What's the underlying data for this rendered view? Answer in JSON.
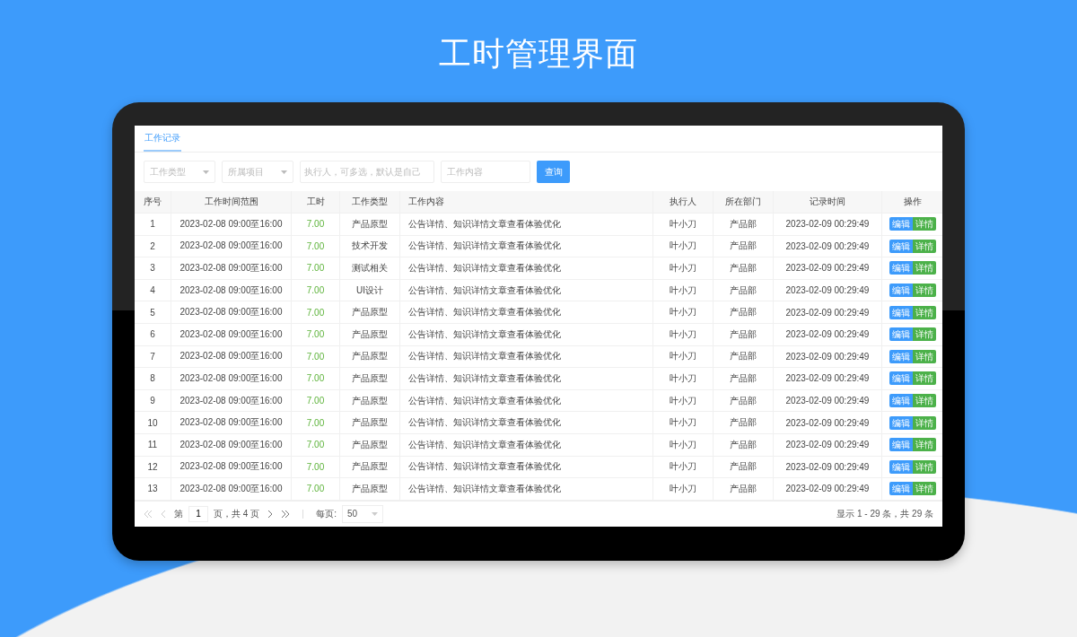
{
  "title": "工时管理界面",
  "tabs": [
    {
      "label": "工作记录",
      "selected": true
    }
  ],
  "filters": [
    {
      "kind": "select",
      "placeholder": "工作类型"
    },
    {
      "kind": "select",
      "placeholder": "所属项目"
    },
    {
      "kind": "input",
      "placeholder": "执行人，可多选，默认是自己"
    },
    {
      "kind": "input",
      "placeholder": "工作内容"
    }
  ],
  "search_button": "查询",
  "table": {
    "columns": [
      "序号",
      "工作时间范围",
      "工时",
      "工作类型",
      "工作内容",
      "执行人",
      "所在部门",
      "记录时间",
      "操作"
    ],
    "rows": [
      {
        "index": "1",
        "range": "2023-02-08 09:00至16:00",
        "hours": "7.00",
        "type": "产品原型",
        "content": "公告详情、知识详情文章查看体验优化",
        "executor": "叶小刀",
        "department": "产品部",
        "recorded": "2023-02-09 00:29:49",
        "actions": [
          {
            "kind": "edit",
            "label": "编辑"
          },
          {
            "kind": "detail",
            "label": "详情"
          }
        ]
      },
      {
        "index": "2",
        "range": "2023-02-08 09:00至16:00",
        "hours": "7.00",
        "type": "技术开发",
        "content": "公告详情、知识详情文章查看体验优化",
        "executor": "叶小刀",
        "department": "产品部",
        "recorded": "2023-02-09 00:29:49",
        "actions": [
          {
            "kind": "edit",
            "label": "编辑"
          },
          {
            "kind": "detail",
            "label": "详情"
          }
        ]
      },
      {
        "index": "3",
        "range": "2023-02-08 09:00至16:00",
        "hours": "7.00",
        "type": "测试相关",
        "content": "公告详情、知识详情文章查看体验优化",
        "executor": "叶小刀",
        "department": "产品部",
        "recorded": "2023-02-09 00:29:49",
        "actions": [
          {
            "kind": "edit",
            "label": "编辑"
          },
          {
            "kind": "detail",
            "label": "详情"
          }
        ]
      },
      {
        "index": "4",
        "range": "2023-02-08 09:00至16:00",
        "hours": "7.00",
        "type": "UI设计",
        "content": "公告详情、知识详情文章查看体验优化",
        "executor": "叶小刀",
        "department": "产品部",
        "recorded": "2023-02-09 00:29:49",
        "actions": [
          {
            "kind": "edit",
            "label": "编辑"
          },
          {
            "kind": "detail",
            "label": "详情"
          }
        ]
      },
      {
        "index": "5",
        "range": "2023-02-08 09:00至16:00",
        "hours": "7.00",
        "type": "产品原型",
        "content": "公告详情、知识详情文章查看体验优化",
        "executor": "叶小刀",
        "department": "产品部",
        "recorded": "2023-02-09 00:29:49",
        "actions": [
          {
            "kind": "edit",
            "label": "编辑"
          },
          {
            "kind": "detail",
            "label": "详情"
          }
        ]
      },
      {
        "index": "6",
        "range": "2023-02-08 09:00至16:00",
        "hours": "7.00",
        "type": "产品原型",
        "content": "公告详情、知识详情文章查看体验优化",
        "executor": "叶小刀",
        "department": "产品部",
        "recorded": "2023-02-09 00:29:49",
        "actions": [
          {
            "kind": "edit",
            "label": "编辑"
          },
          {
            "kind": "detail",
            "label": "详情"
          }
        ]
      },
      {
        "index": "7",
        "range": "2023-02-08 09:00至16:00",
        "hours": "7.00",
        "type": "产品原型",
        "content": "公告详情、知识详情文章查看体验优化",
        "executor": "叶小刀",
        "department": "产品部",
        "recorded": "2023-02-09 00:29:49",
        "actions": [
          {
            "kind": "edit",
            "label": "编辑"
          },
          {
            "kind": "detail",
            "label": "详情"
          }
        ]
      },
      {
        "index": "8",
        "range": "2023-02-08 09:00至16:00",
        "hours": "7.00",
        "type": "产品原型",
        "content": "公告详情、知识详情文章查看体验优化",
        "executor": "叶小刀",
        "department": "产品部",
        "recorded": "2023-02-09 00:29:49",
        "actions": [
          {
            "kind": "edit",
            "label": "编辑"
          },
          {
            "kind": "detail",
            "label": "详情"
          }
        ]
      },
      {
        "index": "9",
        "range": "2023-02-08 09:00至16:00",
        "hours": "7.00",
        "type": "产品原型",
        "content": "公告详情、知识详情文章查看体验优化",
        "executor": "叶小刀",
        "department": "产品部",
        "recorded": "2023-02-09 00:29:49",
        "actions": [
          {
            "kind": "edit",
            "label": "编辑"
          },
          {
            "kind": "detail",
            "label": "详情"
          }
        ]
      },
      {
        "index": "10",
        "range": "2023-02-08 09:00至16:00",
        "hours": "7.00",
        "type": "产品原型",
        "content": "公告详情、知识详情文章查看体验优化",
        "executor": "叶小刀",
        "department": "产品部",
        "recorded": "2023-02-09 00:29:49",
        "actions": [
          {
            "kind": "edit",
            "label": "编辑"
          },
          {
            "kind": "detail",
            "label": "详情"
          }
        ]
      },
      {
        "index": "11",
        "range": "2023-02-08 09:00至16:00",
        "hours": "7.00",
        "type": "产品原型",
        "content": "公告详情、知识详情文章查看体验优化",
        "executor": "叶小刀",
        "department": "产品部",
        "recorded": "2023-02-09 00:29:49",
        "actions": [
          {
            "kind": "edit",
            "label": "编辑"
          },
          {
            "kind": "detail",
            "label": "详情"
          }
        ]
      },
      {
        "index": "12",
        "range": "2023-02-08 09:00至16:00",
        "hours": "7.00",
        "type": "产品原型",
        "content": "公告详情、知识详情文章查看体验优化",
        "executor": "叶小刀",
        "department": "产品部",
        "recorded": "2023-02-09 00:29:49",
        "actions": [
          {
            "kind": "edit",
            "label": "编辑"
          },
          {
            "kind": "detail",
            "label": "详情"
          }
        ]
      },
      {
        "index": "13",
        "range": "2023-02-08 09:00至16:00",
        "hours": "7.00",
        "type": "产品原型",
        "content": "公告详情、知识详情文章查看体验优化",
        "executor": "叶小刀",
        "department": "产品部",
        "recorded": "2023-02-09 00:29:49",
        "actions": [
          {
            "kind": "edit",
            "label": "编辑"
          },
          {
            "kind": "detail",
            "label": "详情"
          }
        ]
      }
    ]
  },
  "pagination": {
    "nav_before": [
      {
        "kind": "first",
        "disabled": true
      },
      {
        "kind": "prev",
        "disabled": true
      }
    ],
    "page_prefix": "第",
    "page": "1",
    "page_suffix": "页，共 4 页",
    "nav_after": [
      {
        "kind": "next",
        "disabled": false
      },
      {
        "kind": "last",
        "disabled": false
      }
    ],
    "per_page_label": "每页:",
    "per_page": "50",
    "summary": "显示 1 - 29 条，共 29 条"
  }
}
